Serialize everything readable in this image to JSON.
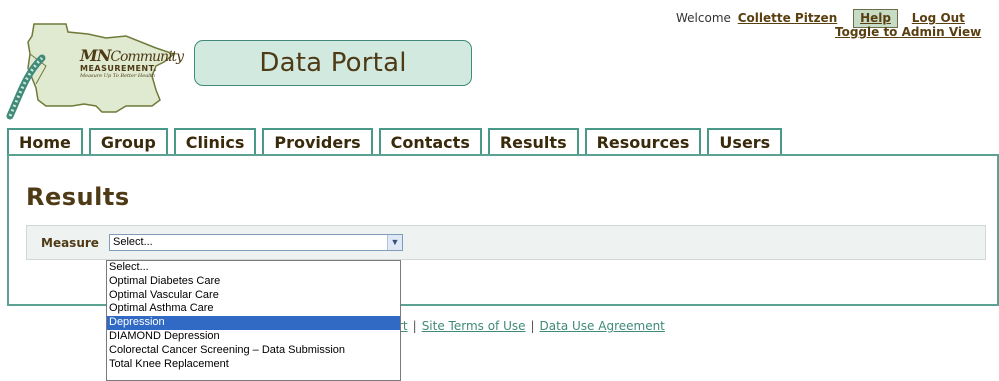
{
  "logo": {
    "mn": "MN",
    "community": "Community",
    "measurement": "MEASUREMENT.",
    "tagline": "Measure Up To Better Health"
  },
  "header": {
    "portal_title": "Data Portal"
  },
  "user": {
    "welcome": "Welcome",
    "name": "Collette Pitzen",
    "help": "Help",
    "logout": "Log Out",
    "toggle": "Toggle to Admin View"
  },
  "tabs": [
    "Home",
    "Group",
    "Clinics",
    "Providers",
    "Contacts",
    "Results",
    "Resources",
    "Users"
  ],
  "page": {
    "title": "Results",
    "measure_label": "Measure",
    "select_value": "Select..."
  },
  "dropdown": {
    "options": [
      "Select...",
      "Optimal Diabetes Care",
      "Optimal Vascular Care",
      "Optimal Asthma Care",
      "Depression",
      "DIAMOND Depression",
      "Colorectal Cancer Screening – Data Submission",
      "Total Knee Replacement"
    ],
    "highlighted": "Depression"
  },
  "footer": {
    "partial": "rt",
    "links": [
      "Site Terms of Use",
      "Data Use Agreement"
    ]
  },
  "colors": {
    "brand_green": "#3f8a78",
    "brand_brown": "#4f3a16",
    "pill_bg": "#d1e9df",
    "selection": "#316ac5"
  }
}
